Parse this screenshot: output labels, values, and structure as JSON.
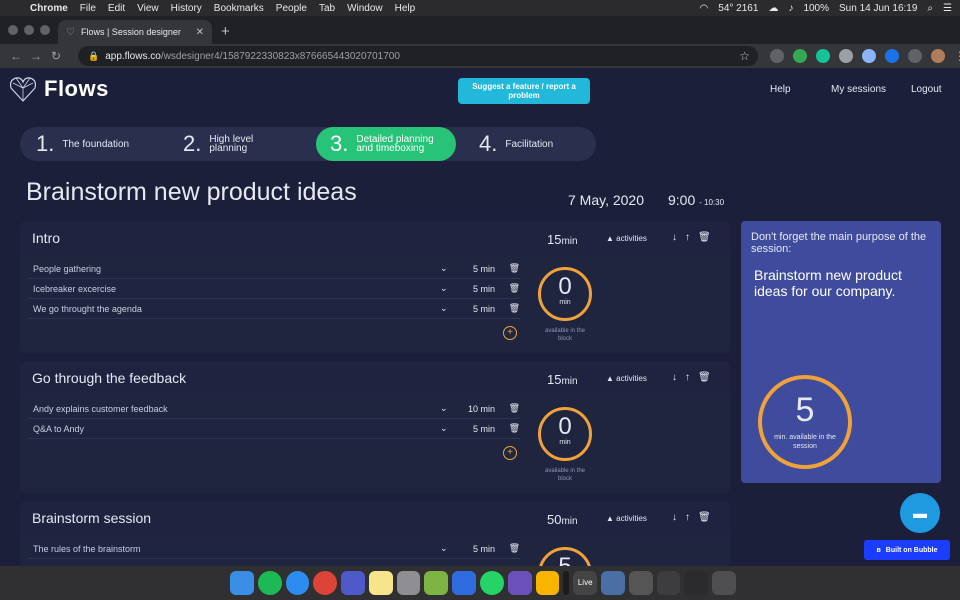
{
  "menubar": {
    "app": "Chrome",
    "items": [
      "File",
      "Edit",
      "View",
      "History",
      "Bookmarks",
      "People",
      "Tab",
      "Window",
      "Help"
    ],
    "status": "54° 2161",
    "battery": "100%",
    "clock": "Sun 14 Jun  16:19"
  },
  "browser": {
    "tab_title": "Flows | Session designer",
    "url_host": "app.flows.co",
    "url_path": "/wsdesigner4/1587922330823x876665443020701700"
  },
  "app": {
    "brand": "Flows",
    "suggest_label": "Suggest a feature / report a problem",
    "nav": {
      "help": "Help",
      "sessions": "My sessions",
      "logout": "Logout"
    },
    "steps": [
      {
        "num": "1.",
        "label": "The foundation"
      },
      {
        "num": "2.",
        "label": "High level planning"
      },
      {
        "num": "3.",
        "label": "Detailed planning and timeboxing"
      },
      {
        "num": "4.",
        "label": "Facilitation"
      }
    ],
    "session": {
      "title": "Brainstorm new product ideas",
      "date": "7 May, 2020",
      "start": "9:00",
      "end": "- 10:30"
    },
    "activities_label": "activities",
    "min_unit": "min",
    "available_label": "available in the block",
    "blocks": [
      {
        "title": "Intro",
        "duration": "15",
        "activities": [
          {
            "name": "People gathering",
            "minutes": "5 min"
          },
          {
            "name": "Icebreaker excercise",
            "minutes": "5 min"
          },
          {
            "name": "We go throught the agenda",
            "minutes": "5 min"
          }
        ],
        "available": "0"
      },
      {
        "title": "Go through the feedback",
        "duration": "15",
        "activities": [
          {
            "name": "Andy explains customer feedback",
            "minutes": "10 min"
          },
          {
            "name": "Q&A to Andy",
            "minutes": "5 min"
          }
        ],
        "available": "0"
      },
      {
        "title": "Brainstorm session",
        "duration": "50",
        "activities": [
          {
            "name": "The rules of the brainstorm",
            "minutes": "5 min"
          }
        ],
        "available": "5"
      }
    ],
    "purpose": {
      "hint": "Don't forget the main purpose of the session:",
      "goal": "Brainstorm new product ideas for our company.",
      "available": "5",
      "available_label": "min. available in the session"
    },
    "built_on": "Built on Bubble"
  },
  "dock": {
    "live_label": "Live"
  },
  "colors": {
    "accent_green": "#27c378",
    "ring_orange": "#f0a23a",
    "panel_blue": "#3f4b9c",
    "cta_cyan": "#22b8d9"
  }
}
